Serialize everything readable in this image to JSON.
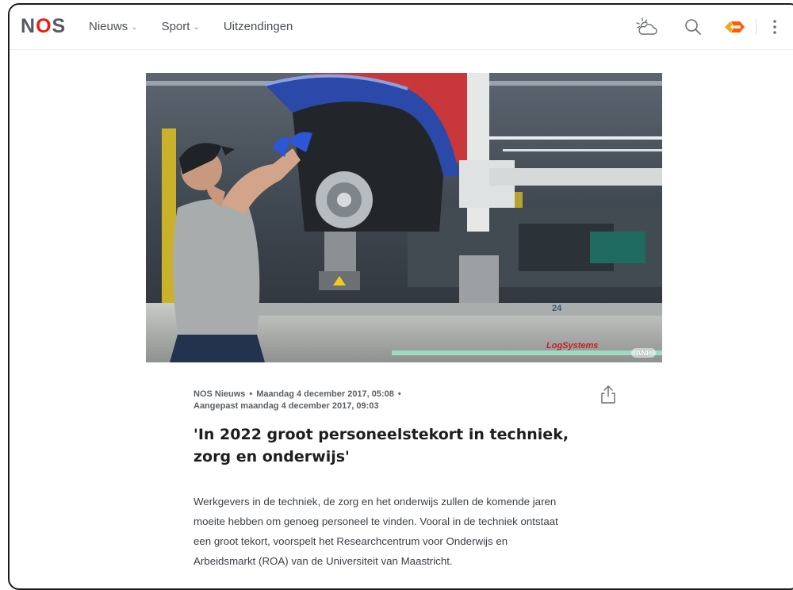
{
  "header": {
    "logo_n": "N",
    "logo_o": "O",
    "logo_s": "S",
    "nav": [
      {
        "label": "Nieuws",
        "has_dropdown": true
      },
      {
        "label": "Sport",
        "has_dropdown": true
      },
      {
        "label": "Uitzendingen",
        "has_dropdown": false
      }
    ],
    "icons": [
      "weather-icon",
      "search-icon",
      "npo-start-icon",
      "more-vertical-icon"
    ],
    "brand_color": "#e61e14"
  },
  "hero": {
    "credit": "ANP",
    "watermark": "LogSystems",
    "station_number": "24"
  },
  "article": {
    "source": "NOS Nieuws",
    "published": "Maandag 4 december 2017, 05:08",
    "updated": "Aangepast maandag 4 december 2017, 09:03",
    "headline_line1": "'In 2022 groot personeelstekort in techniek,",
    "headline_line2": "zorg en onderwijs'",
    "body_lines": [
      "Werkgevers in de techniek, de zorg en het onderwijs zullen de komende jaren",
      "moeite hebben om genoeg personeel te vinden. Vooral in de techniek ontstaat",
      "een groot tekort, voorspelt het Researchcentrum voor Onderwijs en",
      "Arbeidsmarkt (ROA) van de Universiteit van Maastricht."
    ]
  }
}
